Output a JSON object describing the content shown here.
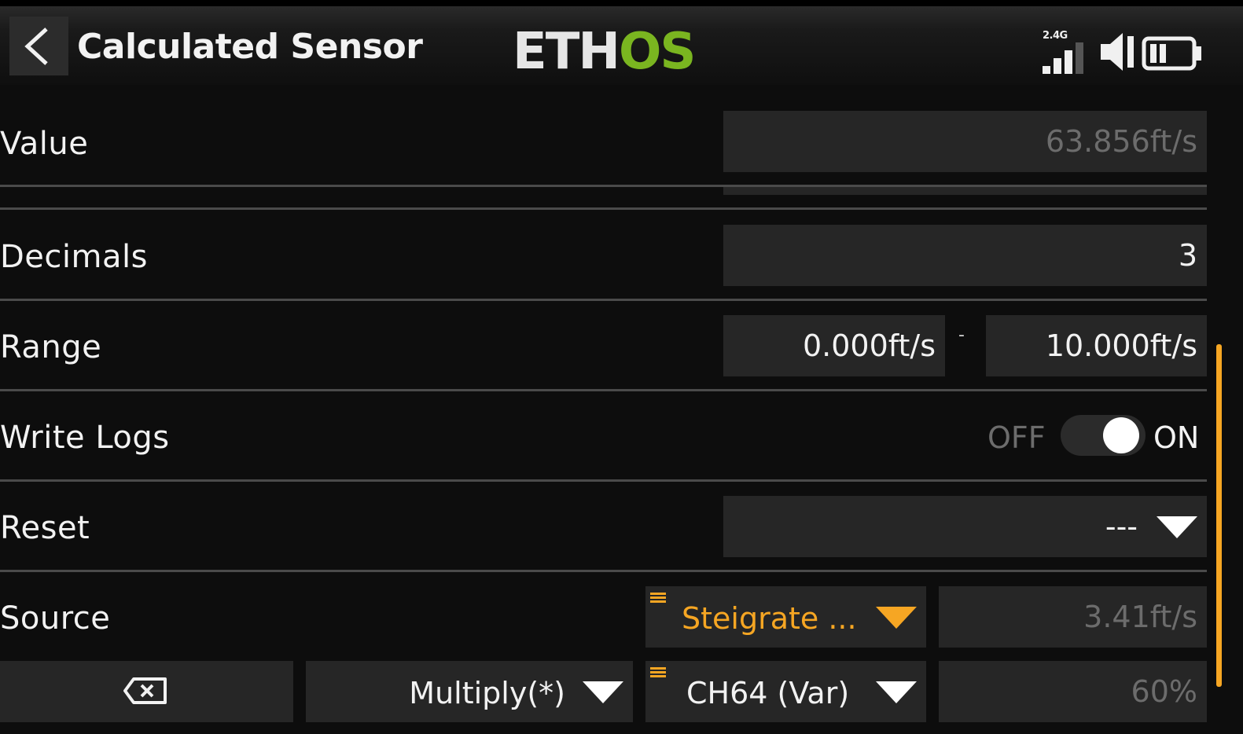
{
  "header": {
    "title": "Calculated Sensor",
    "brand_part1": "ETH",
    "brand_part2": "OS",
    "band": "2.4G",
    "icons": [
      "back-icon",
      "signal-bars-icon",
      "speaker-icon",
      "battery-icon"
    ]
  },
  "rows": {
    "value": {
      "label": "Value",
      "value": "63.856ft/s"
    },
    "decimals": {
      "label": "Decimals",
      "value": "3"
    },
    "range": {
      "label": "Range",
      "min": "0.000ft/s",
      "separator": "-",
      "max": "10.000ft/s"
    },
    "write_logs": {
      "label": "Write Logs",
      "off_label": "OFF",
      "on_label": "ON",
      "state": true
    },
    "reset": {
      "label": "Reset",
      "value": "---"
    },
    "source": {
      "label": "Source",
      "source_value": "Steigrate ...",
      "live_value": "3.41ft/s"
    },
    "operation": {
      "operator": "Multiply(*)",
      "source_value": "CH64 (Var)",
      "live_value": "60%",
      "delete_icon": "delete-icon"
    }
  },
  "colors": {
    "accent": "#f6a623",
    "brand_green": "#7ab520",
    "field_bg": "#262626",
    "background": "#0d0d0d"
  }
}
